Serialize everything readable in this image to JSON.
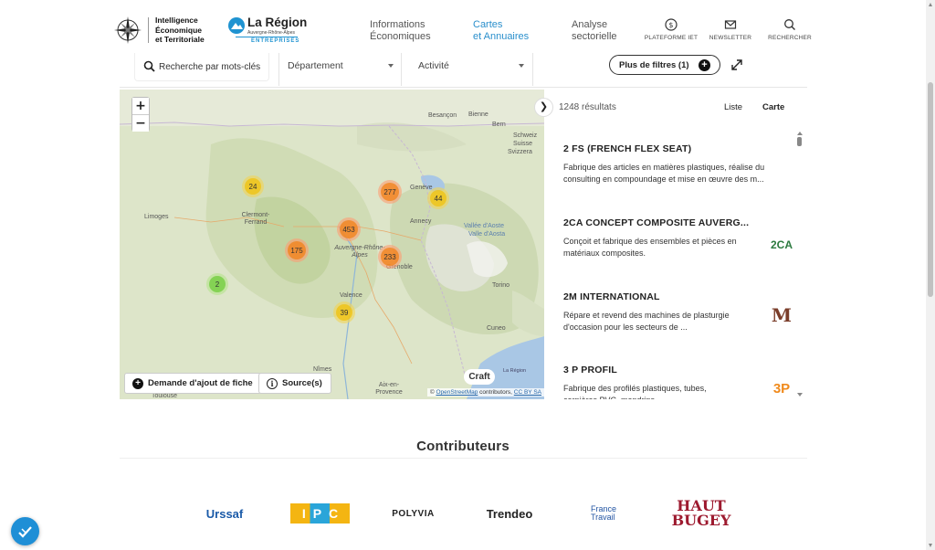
{
  "header": {
    "iet_logo_lines": [
      "Intelligence",
      "Économique",
      "et Territoriale"
    ],
    "region_logo": {
      "title": "La Région",
      "subtitle": "Auvergne-Rhône-Alpes",
      "tagline": "ENTREPRISES"
    },
    "nav": [
      {
        "line1": "Informations",
        "line2": "Économiques",
        "active": false
      },
      {
        "line1": "Cartes",
        "line2": "et Annuaires",
        "active": true
      },
      {
        "line1": "Analyse",
        "line2": "sectorielle",
        "active": false
      }
    ],
    "utilities": [
      {
        "label": "PLATEFORME IET",
        "icon": "euro-coin-icon"
      },
      {
        "label": "NEWSLETTER",
        "icon": "mail-icon"
      },
      {
        "label": "RECHERCHER",
        "icon": "search-icon"
      }
    ]
  },
  "filters": {
    "search_placeholder": "Recherche par mots-clés",
    "department_label": "Département",
    "activity_label": "Activité",
    "more_filters_label": "Plus de filtres (1)",
    "more_filters_icon": "+"
  },
  "map": {
    "zoom_in": "+",
    "zoom_out": "−",
    "clusters": [
      {
        "count": "24",
        "color": "yellow"
      },
      {
        "count": "277",
        "color": "orange"
      },
      {
        "count": "44",
        "color": "yellow"
      },
      {
        "count": "453",
        "color": "orange"
      },
      {
        "count": "175",
        "color": "orange"
      },
      {
        "count": "233",
        "color": "orange"
      },
      {
        "count": "2",
        "color": "green"
      },
      {
        "count": "39",
        "color": "yellow"
      }
    ],
    "places": [
      "Besançon",
      "Bern",
      "Bienne",
      "Schweiz",
      "Suisse",
      "Svizzera",
      "Limoges",
      "Clermont-Ferrand",
      "Genève",
      "Annecy",
      "Auvergne-Rhône-Alpes",
      "Grenoble",
      "Valence",
      "Vallée d'Aoste",
      "Valle d'Aosta",
      "Torino",
      "Cuneo",
      "Nîmes",
      "Aix-en-Provence",
      "Toulouse"
    ],
    "add_sheet_button": "Demande d'ajout de fiche",
    "source_button": "Source(s)",
    "craft_label": "Craft",
    "region_small": "La Région",
    "attribution_prefix": "©",
    "attribution_osm": "OpenStreetMap",
    "attribution_mid": "contributors,",
    "attribution_license": "CC BY SA"
  },
  "results": {
    "count": "1248 résultats",
    "tabs": [
      {
        "label": "Liste",
        "active": false
      },
      {
        "label": "Carte",
        "active": true
      }
    ],
    "items": [
      {
        "title": "2 FS (FRENCH FLEX SEAT)",
        "desc": "Fabrique des articles en matières plastiques, réalise du consulting en compoundage et mise en œuvre des m...",
        "logo": ""
      },
      {
        "title": "2CA CONCEPT COMPOSITE AUVERG...",
        "desc": "Conçoit et fabrique des ensembles et pièces en matériaux composites.",
        "logo": "2CA"
      },
      {
        "title": "2M INTERNATIONAL",
        "desc": "Répare et revend des machines de plasturgie d'occasion pour les secteurs de ...",
        "logo": "M"
      },
      {
        "title": "3 P PROFIL",
        "desc": "Fabrique des profilés plastiques, tubes, cornières PVC, mandrins...",
        "logo": "3P"
      }
    ]
  },
  "contributors": {
    "title": "Contributeurs",
    "partners": [
      "Urssaf",
      "IPC",
      "POLYVIA",
      "Trendeo",
      "France Travail",
      "HAUT BUGEY"
    ]
  },
  "colors": {
    "brand_blue": "#1f93d1",
    "nav_active": "#2a8fcc",
    "cluster_yellow": "#f0c20c",
    "cluster_orange": "#f18017",
    "cluster_green": "#6ecc39"
  }
}
